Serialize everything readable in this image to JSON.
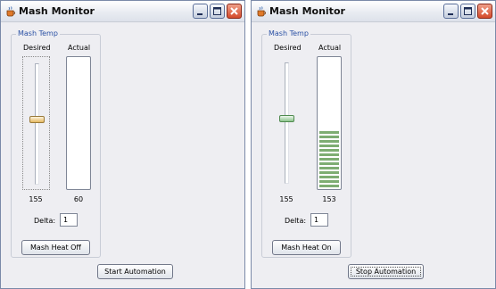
{
  "windows": [
    {
      "title": "Mash Monitor",
      "group_label": "Mash Temp",
      "desired_label": "Desired",
      "actual_label": "Actual",
      "desired_value": "155",
      "actual_value": "60",
      "delta_label": "Delta:",
      "delta_value": "1",
      "heat_button": "Mash Heat Off",
      "automation_button": "Start Automation",
      "actual_level_percent": 0,
      "slider_focused": true,
      "automation_focused": false
    },
    {
      "title": "Mash Monitor",
      "group_label": "Mash Temp",
      "desired_label": "Desired",
      "actual_label": "Actual",
      "desired_value": "155",
      "actual_value": "153",
      "delta_label": "Delta:",
      "delta_value": "1",
      "heat_button": "Mash Heat On",
      "automation_button": "Stop Automation",
      "actual_level_percent": 48,
      "slider_focused": false,
      "automation_focused": true
    }
  ],
  "colors": {
    "level_fill": "#7ead72",
    "group_label": "#2a50a4",
    "close_button": "#d44a2a"
  },
  "icons": [
    "java-cup-icon",
    "minimize-icon",
    "maximize-icon",
    "close-icon"
  ]
}
